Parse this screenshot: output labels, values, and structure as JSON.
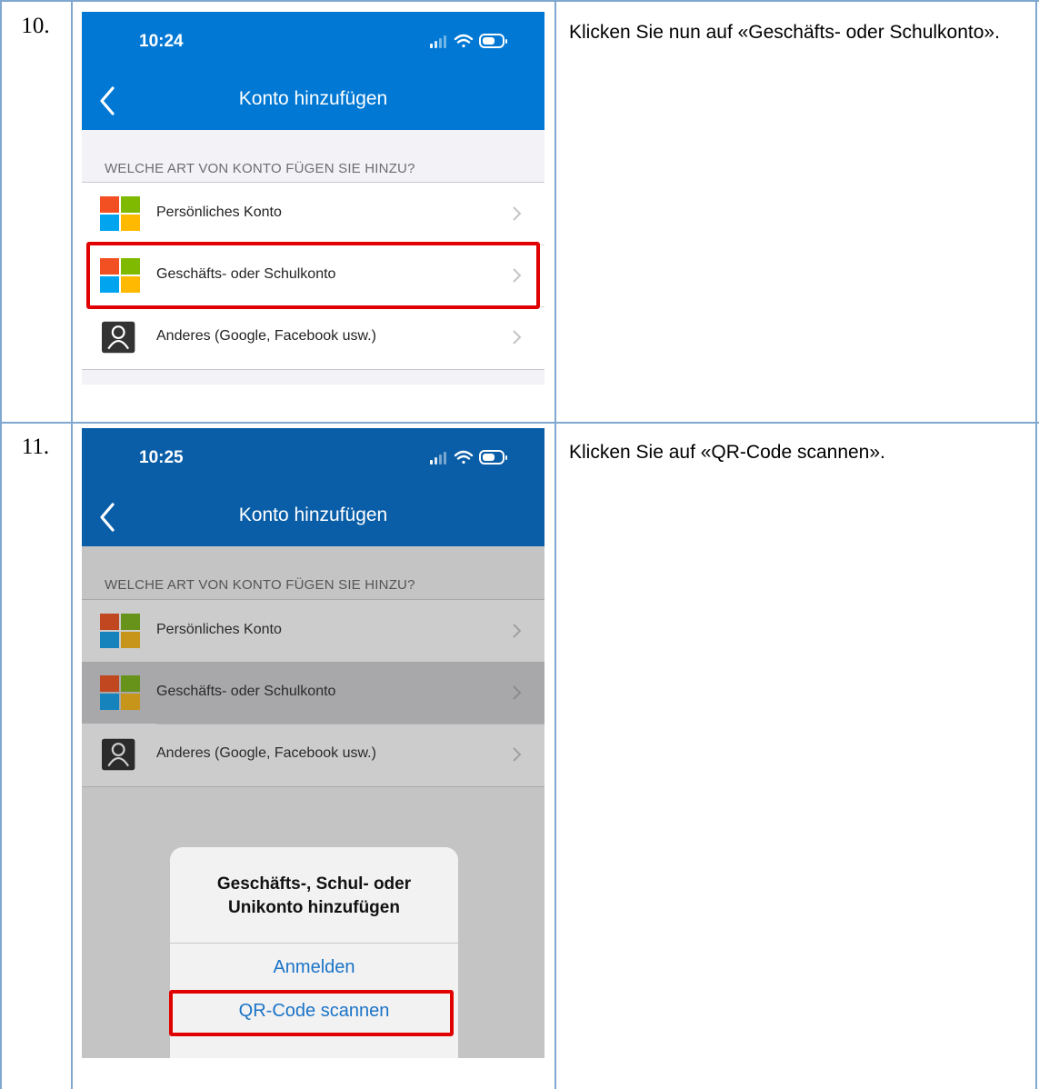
{
  "steps": [
    {
      "number": "10.",
      "instruction": "Klicken Sie nun auf «Geschäfts- oder Schulkonto».",
      "phone": {
        "time": "10:24",
        "nav_title": "Konto hinzufügen",
        "section_label": "WELCHE ART VON KONTO FÜGEN SIE HINZU?",
        "rows": [
          {
            "label": "Persönliches Konto",
            "icon": "microsoft-logo-icon"
          },
          {
            "label": "Geschäfts- oder Schulkonto",
            "icon": "microsoft-logo-icon"
          },
          {
            "label": "Anderes (Google, Facebook usw.)",
            "icon": "person-icon"
          }
        ],
        "highlighted_row": "Geschäfts- oder Schulkonto"
      }
    },
    {
      "number": "11.",
      "instruction": "Klicken Sie auf «QR-Code scannen».",
      "phone": {
        "time": "10:25",
        "nav_title": "Konto hinzufügen",
        "section_label": "WELCHE ART VON KONTO FÜGEN SIE HINZU?",
        "rows": [
          {
            "label": "Persönliches Konto",
            "icon": "microsoft-logo-icon"
          },
          {
            "label": "Geschäfts- oder Schulkonto",
            "icon": "microsoft-logo-icon"
          },
          {
            "label": "Anderes (Google, Facebook usw.)",
            "icon": "person-icon"
          }
        ],
        "dialog": {
          "title_line1": "Geschäfts-, Schul- oder",
          "title_line2": "Unikonto hinzufügen",
          "button_signin": "Anmelden",
          "button_qr": "QR-Code scannen"
        },
        "highlighted_button": "QR-Code scannen"
      }
    }
  ],
  "colors": {
    "ios_blue": "#0078d4",
    "ios_blue_dimmed": "#0a5ea8",
    "highlight_red": "#e10000",
    "ms_red": "#f25022",
    "ms_green": "#7fba00",
    "ms_blue": "#00a4ef",
    "ms_yellow": "#ffb900",
    "table_border": "#7fa7cf"
  }
}
